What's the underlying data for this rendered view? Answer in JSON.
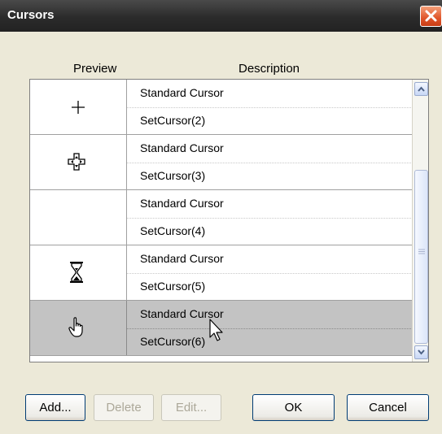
{
  "window": {
    "title": "Cursors"
  },
  "columns": {
    "preview": "Preview",
    "description": "Description"
  },
  "rows": [
    {
      "line1": "Standard Cursor",
      "line2": "SetCursor(2)",
      "icon": "crosshair-icon",
      "selected": false
    },
    {
      "line1": "Standard Cursor",
      "line2": "SetCursor(3)",
      "icon": "move-icon",
      "selected": false
    },
    {
      "line1": "Standard Cursor",
      "line2": "SetCursor(4)",
      "icon": "",
      "selected": false
    },
    {
      "line1": "Standard Cursor",
      "line2": "SetCursor(5)",
      "icon": "hourglass-icon",
      "selected": false
    },
    {
      "line1": "Standard Cursor",
      "line2": "SetCursor(6)",
      "icon": "hand-pointer-icon",
      "selected": true
    }
  ],
  "buttons": {
    "add": "Add...",
    "delete": "Delete",
    "edit": "Edit...",
    "ok": "OK",
    "cancel": "Cancel"
  },
  "colors": {
    "selected_row": "#c3c3c3",
    "title_bar": "#2b2b2b",
    "close_button": "#e0552a"
  }
}
